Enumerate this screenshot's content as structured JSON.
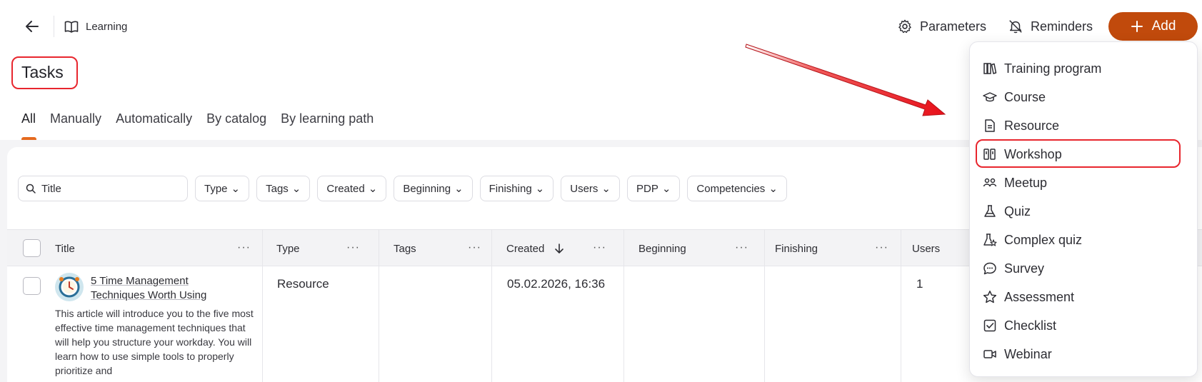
{
  "header": {
    "breadcrumb": "Learning",
    "parameters_label": "Parameters",
    "reminders_label": "Reminders",
    "add_label": "Add"
  },
  "page": {
    "title": "Tasks"
  },
  "tabs": [
    {
      "label": "All",
      "active": true
    },
    {
      "label": "Manually"
    },
    {
      "label": "Automatically"
    },
    {
      "label": "By catalog"
    },
    {
      "label": "By learning path"
    }
  ],
  "filters": {
    "search_value": "Title",
    "chips": [
      "Type",
      "Tags",
      "Created",
      "Beginning",
      "Finishing",
      "Users",
      "PDP",
      "Competencies"
    ]
  },
  "table": {
    "columns": [
      "Title",
      "Type",
      "Tags",
      "Created",
      "Beginning",
      "Finishing",
      "Users"
    ],
    "rows": [
      {
        "title": "5 Time Management Techniques Worth Using",
        "description": "This article will introduce you to the five most effective time management techniques that will help you structure your workday. You will learn how to use simple tools to properly prioritize and",
        "type": "Resource",
        "tags": "",
        "created": "05.02.2026, 16:36",
        "beginning": "",
        "finishing": "",
        "users": "1"
      }
    ]
  },
  "add_menu": {
    "items": [
      {
        "label": "Training program",
        "icon": "books-icon"
      },
      {
        "label": "Course",
        "icon": "graduation-cap-icon"
      },
      {
        "label": "Resource",
        "icon": "document-icon"
      },
      {
        "label": "Workshop",
        "icon": "workshop-icon",
        "highlighted": true
      },
      {
        "label": "Meetup",
        "icon": "people-icon"
      },
      {
        "label": "Quiz",
        "icon": "flask-icon"
      },
      {
        "label": "Complex quiz",
        "icon": "flask-star-icon"
      },
      {
        "label": "Survey",
        "icon": "chat-bubble-icon"
      },
      {
        "label": "Assessment",
        "icon": "star-icon"
      },
      {
        "label": "Checklist",
        "icon": "checkbox-icon"
      },
      {
        "label": "Webinar",
        "icon": "video-icon"
      }
    ]
  },
  "colors": {
    "accent": "#c14a0c",
    "annotation": "#e8262e",
    "tab_indicator": "#e56a1f"
  }
}
